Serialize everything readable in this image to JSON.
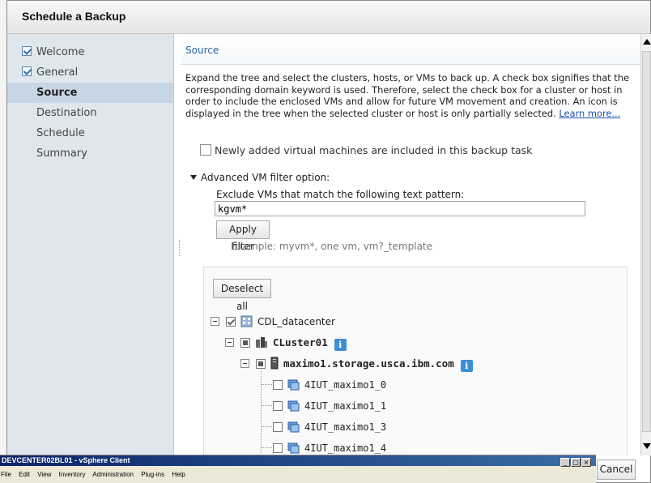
{
  "dialog": {
    "title": "Schedule a Backup"
  },
  "nav": {
    "items": [
      {
        "label": "Welcome",
        "done": true
      },
      {
        "label": "General",
        "done": true
      },
      {
        "label": "Source",
        "active": true
      },
      {
        "label": "Destination"
      },
      {
        "label": "Schedule"
      },
      {
        "label": "Summary"
      }
    ]
  },
  "content": {
    "section_title": "Source",
    "description": "Expand the tree and select the clusters, hosts, or VMs to back up. A check box signifies that the corresponding domain keyword is used. Therefore, select the check box for a cluster or host in order to include the enclosed VMs and allow for future VM movement and creation. An icon is displayed in the tree when the selected cluster or host is only partially selected.",
    "learn_more": "Learn more...",
    "new_vms_label": "Newly added virtual machines are included in this backup task",
    "advanced_label": "Advanced VM filter option:",
    "exclude_label": "Exclude VMs that match the following text pattern:",
    "pattern_value": "kgvm*",
    "apply_label": "Apply filter",
    "example": "Example: myvm*, one vm, vm?_template",
    "deselect_label": "Deselect all"
  },
  "tree": {
    "datacenter": "CDL_datacenter",
    "cluster": "CLuster01",
    "host": "maximo1.storage.usca.ibm.com",
    "vms": [
      "4IUT_maximo1_0",
      "4IUT_maximo1_1",
      "4IUT_maximo1_3",
      "4IUT_maximo1_4"
    ]
  },
  "taskbar": {
    "title": "DEVCENTER02BL01 - vSphere Client",
    "menu": [
      "File",
      "Edit",
      "View",
      "Inventory",
      "Administration",
      "Plug-ins",
      "Help"
    ]
  },
  "footer": {
    "cancel_label": "Cancel"
  }
}
